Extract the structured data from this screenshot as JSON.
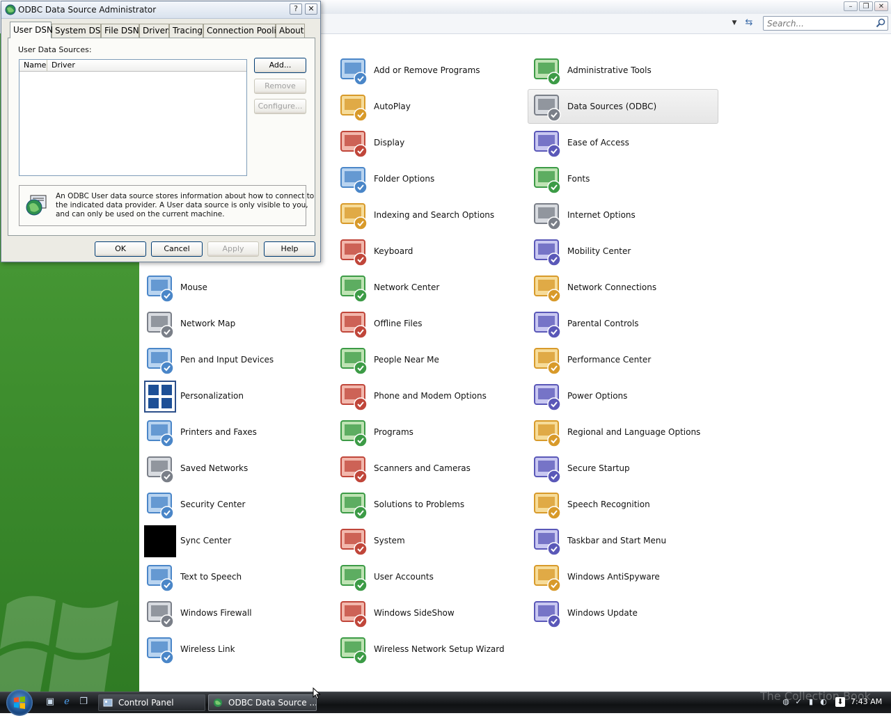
{
  "control_panel": {
    "search_placeholder": "Search...",
    "items": [
      {
        "label": "Add or Remove Programs",
        "icon": "add-remove-programs-icon",
        "col": 1,
        "row": 0
      },
      {
        "label": "Administrative Tools",
        "icon": "administrative-tools-icon",
        "col": 2,
        "row": 0
      },
      {
        "label": "AutoPlay",
        "icon": "autoplay-icon",
        "col": 1,
        "row": 1
      },
      {
        "label": "Data Sources (ODBC)",
        "icon": "data-sources-odbc-icon",
        "col": 2,
        "row": 1,
        "selected": true
      },
      {
        "label": "Display",
        "icon": "display-icon",
        "col": 1,
        "row": 2
      },
      {
        "label": "Ease of Access",
        "icon": "ease-of-access-icon",
        "col": 2,
        "row": 2
      },
      {
        "label": "Folder Options",
        "icon": "folder-options-icon",
        "col": 1,
        "row": 3
      },
      {
        "label": "Fonts",
        "icon": "fonts-icon",
        "col": 2,
        "row": 3
      },
      {
        "label": "Indexing and Search Options",
        "icon": "indexing-search-icon",
        "col": 1,
        "row": 4
      },
      {
        "label": "Internet Options",
        "icon": "internet-options-icon",
        "col": 2,
        "row": 4
      },
      {
        "label": "Keyboard",
        "icon": "keyboard-icon",
        "col": 1,
        "row": 5
      },
      {
        "label": "Mobility Center",
        "icon": "mobility-center-icon",
        "col": 2,
        "row": 5
      },
      {
        "label": "Mouse",
        "icon": "mouse-icon",
        "col": 0,
        "row": 6
      },
      {
        "label": "Network Center",
        "icon": "network-center-icon",
        "col": 1,
        "row": 6
      },
      {
        "label": "Network Connections",
        "icon": "network-connections-icon",
        "col": 2,
        "row": 6
      },
      {
        "label": "Network Map",
        "icon": "network-map-icon",
        "col": 0,
        "row": 7
      },
      {
        "label": "Offline Files",
        "icon": "offline-files-icon",
        "col": 1,
        "row": 7
      },
      {
        "label": "Parental Controls",
        "icon": "parental-controls-icon",
        "col": 2,
        "row": 7
      },
      {
        "label": "Pen and Input Devices",
        "icon": "pen-input-icon",
        "col": 0,
        "row": 8
      },
      {
        "label": "People Near Me",
        "icon": "people-near-me-icon",
        "col": 1,
        "row": 8
      },
      {
        "label": "Performance Center",
        "icon": "performance-center-icon",
        "col": 2,
        "row": 8
      },
      {
        "label": "Personalization",
        "icon": "personalization-icon",
        "col": 0,
        "row": 9
      },
      {
        "label": "Phone and Modem Options",
        "icon": "phone-modem-icon",
        "col": 1,
        "row": 9
      },
      {
        "label": "Power Options",
        "icon": "power-options-icon",
        "col": 2,
        "row": 9
      },
      {
        "label": "Printers and Faxes",
        "icon": "printers-faxes-icon",
        "col": 0,
        "row": 10
      },
      {
        "label": "Programs",
        "icon": "programs-icon",
        "col": 1,
        "row": 10
      },
      {
        "label": "Regional and Language Options",
        "icon": "regional-language-icon",
        "col": 2,
        "row": 10
      },
      {
        "label": "Saved Networks",
        "icon": "saved-networks-icon",
        "col": 0,
        "row": 11
      },
      {
        "label": "Scanners and Cameras",
        "icon": "scanners-cameras-icon",
        "col": 1,
        "row": 11
      },
      {
        "label": "Secure Startup",
        "icon": "secure-startup-icon",
        "col": 2,
        "row": 11
      },
      {
        "label": "Security Center",
        "icon": "security-center-icon",
        "col": 0,
        "row": 12
      },
      {
        "label": "Solutions to Problems",
        "icon": "solutions-problems-icon",
        "col": 1,
        "row": 12
      },
      {
        "label": "Speech Recognition",
        "icon": "speech-recognition-icon",
        "col": 2,
        "row": 12
      },
      {
        "label": "Sync Center",
        "icon": "sync-center-icon",
        "col": 0,
        "row": 13
      },
      {
        "label": "System",
        "icon": "system-icon",
        "col": 1,
        "row": 13
      },
      {
        "label": "Taskbar and Start Menu",
        "icon": "taskbar-start-menu-icon",
        "col": 2,
        "row": 13
      },
      {
        "label": "Text to Speech",
        "icon": "text-to-speech-icon",
        "col": 0,
        "row": 14
      },
      {
        "label": "User Accounts",
        "icon": "user-accounts-icon",
        "col": 1,
        "row": 14
      },
      {
        "label": "Windows AntiSpyware",
        "icon": "windows-antispyware-icon",
        "col": 2,
        "row": 14
      },
      {
        "label": "Windows Firewall",
        "icon": "windows-firewall-icon",
        "col": 0,
        "row": 15
      },
      {
        "label": "Windows SideShow",
        "icon": "windows-sideshow-icon",
        "col": 1,
        "row": 15
      },
      {
        "label": "Windows Update",
        "icon": "windows-update-icon",
        "col": 2,
        "row": 15
      },
      {
        "label": "Wireless Link",
        "icon": "wireless-link-icon",
        "col": 0,
        "row": 16
      },
      {
        "label": "Wireless Network Setup Wizard",
        "icon": "wireless-network-setup-icon",
        "col": 1,
        "row": 16
      }
    ]
  },
  "odbc_dialog": {
    "title": "ODBC Data Source Administrator",
    "help_button": "?",
    "close_button": "✕",
    "tabs": [
      "User DSN",
      "System DSN",
      "File DSN",
      "Drivers",
      "Tracing",
      "Connection Pooling",
      "About"
    ],
    "active_tab": "User DSN",
    "sources_label": "User Data Sources:",
    "columns": [
      "Name",
      "Driver"
    ],
    "rows": [],
    "side_buttons": {
      "add": "Add...",
      "remove": "Remove",
      "configure": "Configure..."
    },
    "info_lines": [
      "An ODBC User data source stores information about how to connect to",
      "the indicated data provider.   A User data source is only visible to you,",
      "and can only be used on the current machine."
    ],
    "buttons": {
      "ok": "OK",
      "cancel": "Cancel",
      "apply": "Apply",
      "help": "Help"
    }
  },
  "taskbar": {
    "buttons": [
      {
        "label": "Control Panel",
        "icon": "control-panel-icon"
      },
      {
        "label": "ODBC Data Source ...",
        "icon": "odbc-icon",
        "active": true
      }
    ],
    "clock": "7:43 AM",
    "watermark": "The Collection Book"
  },
  "colors": {
    "sidebar_green": "#3e8e2e",
    "selection": "#e6e6e6",
    "dialog_face": "#ecebe4"
  }
}
